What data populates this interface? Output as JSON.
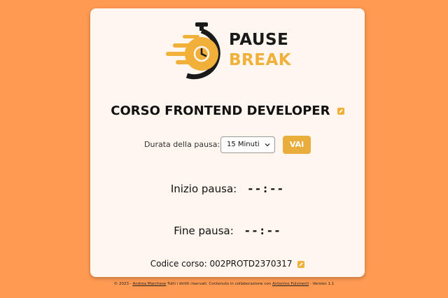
{
  "logo": {
    "line1": "PAUSE",
    "line2": "BREAK",
    "icon": "stopwatch-icon"
  },
  "course": {
    "title": "CORSO FRONTEND DEVELOPER",
    "edit_icon": "edit-icon"
  },
  "duration": {
    "label": "Durata della pausa:",
    "selected": "15 Minuti",
    "button_label": "VAI"
  },
  "start": {
    "label": "Inizio pausa:",
    "value": "--:--"
  },
  "end": {
    "label": "Fine pausa:",
    "value": "--:--"
  },
  "code": {
    "label": "Codice corso: 002PROTD2370317"
  },
  "footer": {
    "prefix": "© 2023 - ",
    "author": "Andrea Marchese",
    "middle": " Tutti i diritti riservati. Contenuto in collaborazione con ",
    "collaborator": "Antonino Pulvirenti",
    "suffix": " - Version 1.1"
  },
  "colors": {
    "background": "#fe9a52",
    "card": "#fff6f0",
    "accent": "#f1b03a",
    "button": "#e9ad3c"
  }
}
